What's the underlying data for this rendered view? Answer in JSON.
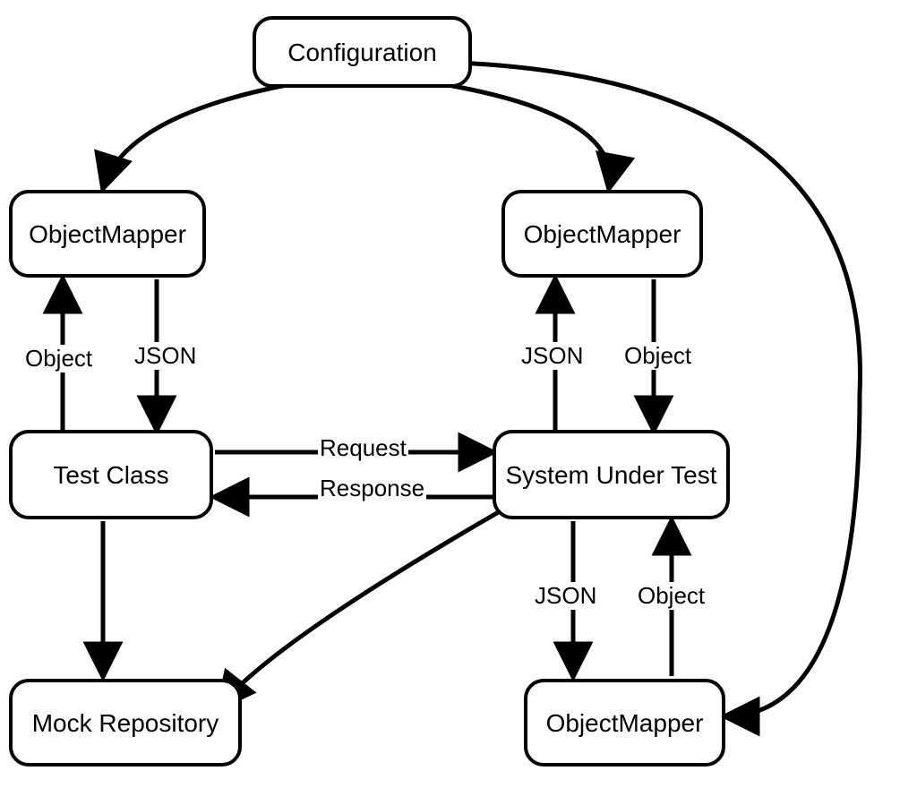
{
  "nodes": {
    "configuration": "Configuration",
    "mapperLeft": "ObjectMapper",
    "mapperRight": "ObjectMapper",
    "testClass": "Test Class",
    "sut": "System Under Test",
    "mapperBottom": "ObjectMapper",
    "mockRepo": "Mock Repository"
  },
  "labels": {
    "objectL": "Object",
    "jsonL": "JSON",
    "jsonR": "JSON",
    "objectR": "Object",
    "request": "Request",
    "response": "Response",
    "jsonB": "JSON",
    "objectB": "Object"
  }
}
